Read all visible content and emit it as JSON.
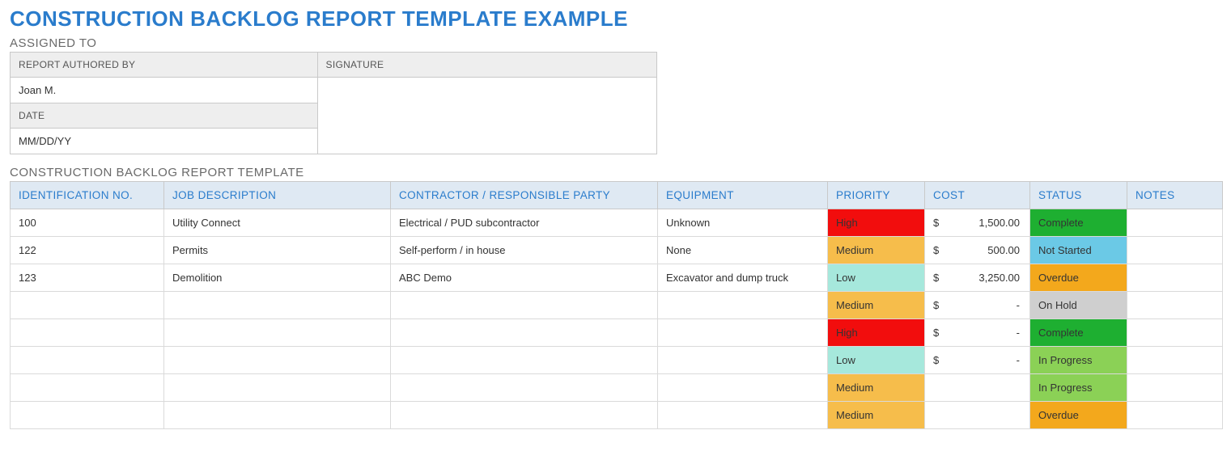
{
  "title": "CONSTRUCTION BACKLOG REPORT TEMPLATE EXAMPLE",
  "assigned": {
    "heading": "ASSIGNED TO",
    "labels": {
      "authored_by": "REPORT AUTHORED BY",
      "signature": "SIGNATURE",
      "date": "DATE"
    },
    "values": {
      "authored_by": "Joan M.",
      "signature": "",
      "date": "MM/DD/YY"
    }
  },
  "backlog": {
    "heading": "CONSTRUCTION BACKLOG REPORT TEMPLATE",
    "columns": {
      "id": "IDENTIFICATION NO.",
      "job": "JOB DESCRIPTION",
      "contractor": "CONTRACTOR / RESPONSIBLE PARTY",
      "equipment": "EQUIPMENT",
      "priority": "PRIORITY",
      "cost": "COST",
      "status": "STATUS",
      "notes": "NOTES"
    },
    "currency": "$",
    "rows": [
      {
        "id": "100",
        "job": "Utility Connect",
        "contractor": "Electrical / PUD subcontractor",
        "equipment": "Unknown",
        "priority": "High",
        "cost": "1,500.00",
        "status": "Complete",
        "notes": ""
      },
      {
        "id": "122",
        "job": "Permits",
        "contractor": "Self-perform / in house",
        "equipment": "None",
        "priority": "Medium",
        "cost": "500.00",
        "status": "Not Started",
        "notes": ""
      },
      {
        "id": "123",
        "job": "Demolition",
        "contractor": "ABC Demo",
        "equipment": "Excavator and dump truck",
        "priority": "Low",
        "cost": "3,250.00",
        "status": "Overdue",
        "notes": ""
      },
      {
        "id": "",
        "job": "",
        "contractor": "",
        "equipment": "",
        "priority": "Medium",
        "cost": "-",
        "status": "On Hold",
        "notes": ""
      },
      {
        "id": "",
        "job": "",
        "contractor": "",
        "equipment": "",
        "priority": "High",
        "cost": "-",
        "status": "Complete",
        "notes": ""
      },
      {
        "id": "",
        "job": "",
        "contractor": "",
        "equipment": "",
        "priority": "Low",
        "cost": "-",
        "status": "In Progress",
        "notes": ""
      },
      {
        "id": "",
        "job": "",
        "contractor": "",
        "equipment": "",
        "priority": "Medium",
        "cost": "",
        "status": "In Progress",
        "notes": ""
      },
      {
        "id": "",
        "job": "",
        "contractor": "",
        "equipment": "",
        "priority": "Medium",
        "cost": "",
        "status": "Overdue",
        "notes": ""
      }
    ]
  },
  "colors": {
    "priority": {
      "High": "pri-high",
      "Medium": "pri-medium",
      "Low": "pri-low"
    },
    "status": {
      "Complete": "st-complete",
      "Not Started": "st-notstarted",
      "Overdue": "st-overdue",
      "On Hold": "st-onhold",
      "In Progress": "st-inprogress"
    }
  }
}
